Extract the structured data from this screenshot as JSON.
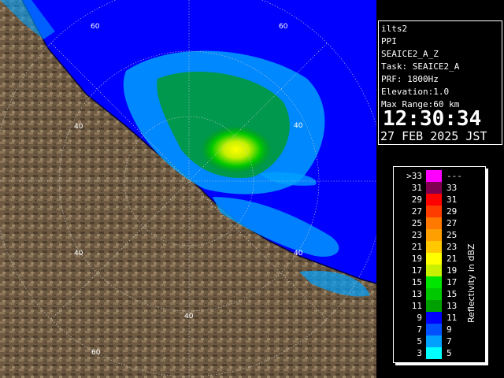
{
  "radar": {
    "range_ring_labels": [
      "60",
      "60",
      "40",
      "40",
      "40",
      "40",
      "60"
    ]
  },
  "info": {
    "station": "ilts2",
    "mode": "PPI",
    "product": "SEAICE2_A_Z",
    "task": "Task: SEAICE2_A",
    "prf": "PRF: 1800Hz",
    "elevation": "Elevation:1.0",
    "max_range": "Max Range:60 km",
    "time": "12:30:34",
    "date": "27 FEB 2025 JST"
  },
  "legend": {
    "unit_label": "Reflectivity in dBZ",
    "rows": [
      {
        "left": ">33",
        "right": "---",
        "color": "#ff00ff"
      },
      {
        "left": "31",
        "right": "33",
        "color": "#800050"
      },
      {
        "left": "29",
        "right": "31",
        "color": "#ff0000"
      },
      {
        "left": "27",
        "right": "29",
        "color": "#ff3c00"
      },
      {
        "left": "25",
        "right": "27",
        "color": "#ff7800"
      },
      {
        "left": "23",
        "right": "25",
        "color": "#ffa000"
      },
      {
        "left": "21",
        "right": "23",
        "color": "#ffc800"
      },
      {
        "left": "19",
        "right": "21",
        "color": "#ffff00"
      },
      {
        "left": "17",
        "right": "19",
        "color": "#c8f000"
      },
      {
        "left": "15",
        "right": "17",
        "color": "#00e600"
      },
      {
        "left": "13",
        "right": "15",
        "color": "#00c800"
      },
      {
        "left": "11",
        "right": "13",
        "color": "#00a000"
      },
      {
        "left": "9",
        "right": "11",
        "color": "#0000ff"
      },
      {
        "left": "7",
        "right": "9",
        "color": "#0050ff"
      },
      {
        "left": "5",
        "right": "7",
        "color": "#00a0ff"
      },
      {
        "left": "3",
        "right": "5",
        "color": "#00ffff"
      }
    ]
  }
}
